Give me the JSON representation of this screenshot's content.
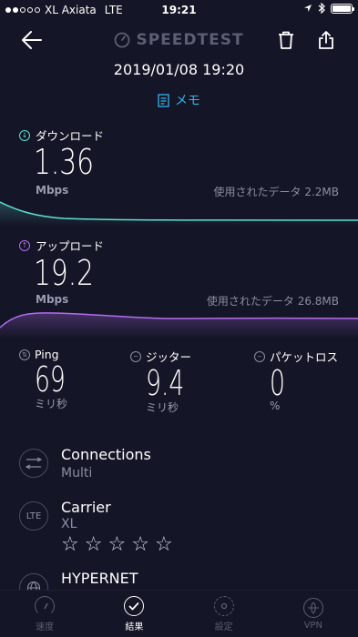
{
  "status_bar": {
    "carrier": "XL Axiata",
    "network": "LTE",
    "time": "19:21"
  },
  "header": {
    "title": "SPEEDTEST",
    "back_icon": "back-arrow-icon",
    "trash_icon": "trash-icon",
    "share_icon": "share-icon"
  },
  "result": {
    "datetime": "2019/01/08 19:20",
    "memo_label": "メモ"
  },
  "download": {
    "label": "ダウンロード",
    "value": "1.36",
    "unit": "Mbps",
    "data_used": "使用されたデータ 2.2MB",
    "color": "#5de0d2"
  },
  "upload": {
    "label": "アップロード",
    "value": "19.2",
    "unit": "Mbps",
    "data_used": "使用されたデータ 26.8MB",
    "color": "#b36cf0"
  },
  "metrics": {
    "ping": {
      "label": "Ping",
      "value": "69",
      "unit": "ミリ秒"
    },
    "jitter": {
      "label": "ジッター",
      "value": "9.4",
      "unit": "ミリ秒"
    },
    "loss": {
      "label": "パケットロス",
      "value": "0",
      "unit": "%"
    }
  },
  "info": {
    "connections": {
      "title": "Connections",
      "value": "Multi"
    },
    "carrier": {
      "icon_text": "LTE",
      "title": "Carrier",
      "value": "XL",
      "rating": 0,
      "rating_max": 5
    },
    "server": {
      "title": "HYPERNET"
    }
  },
  "tabbar": {
    "speed": "速度",
    "results": "結果",
    "settings": "設定",
    "vpn": "VPN"
  },
  "colors": {
    "background": "#141526",
    "accent_blue": "#35b3f0",
    "download": "#5de0d2",
    "upload": "#b36cf0"
  }
}
